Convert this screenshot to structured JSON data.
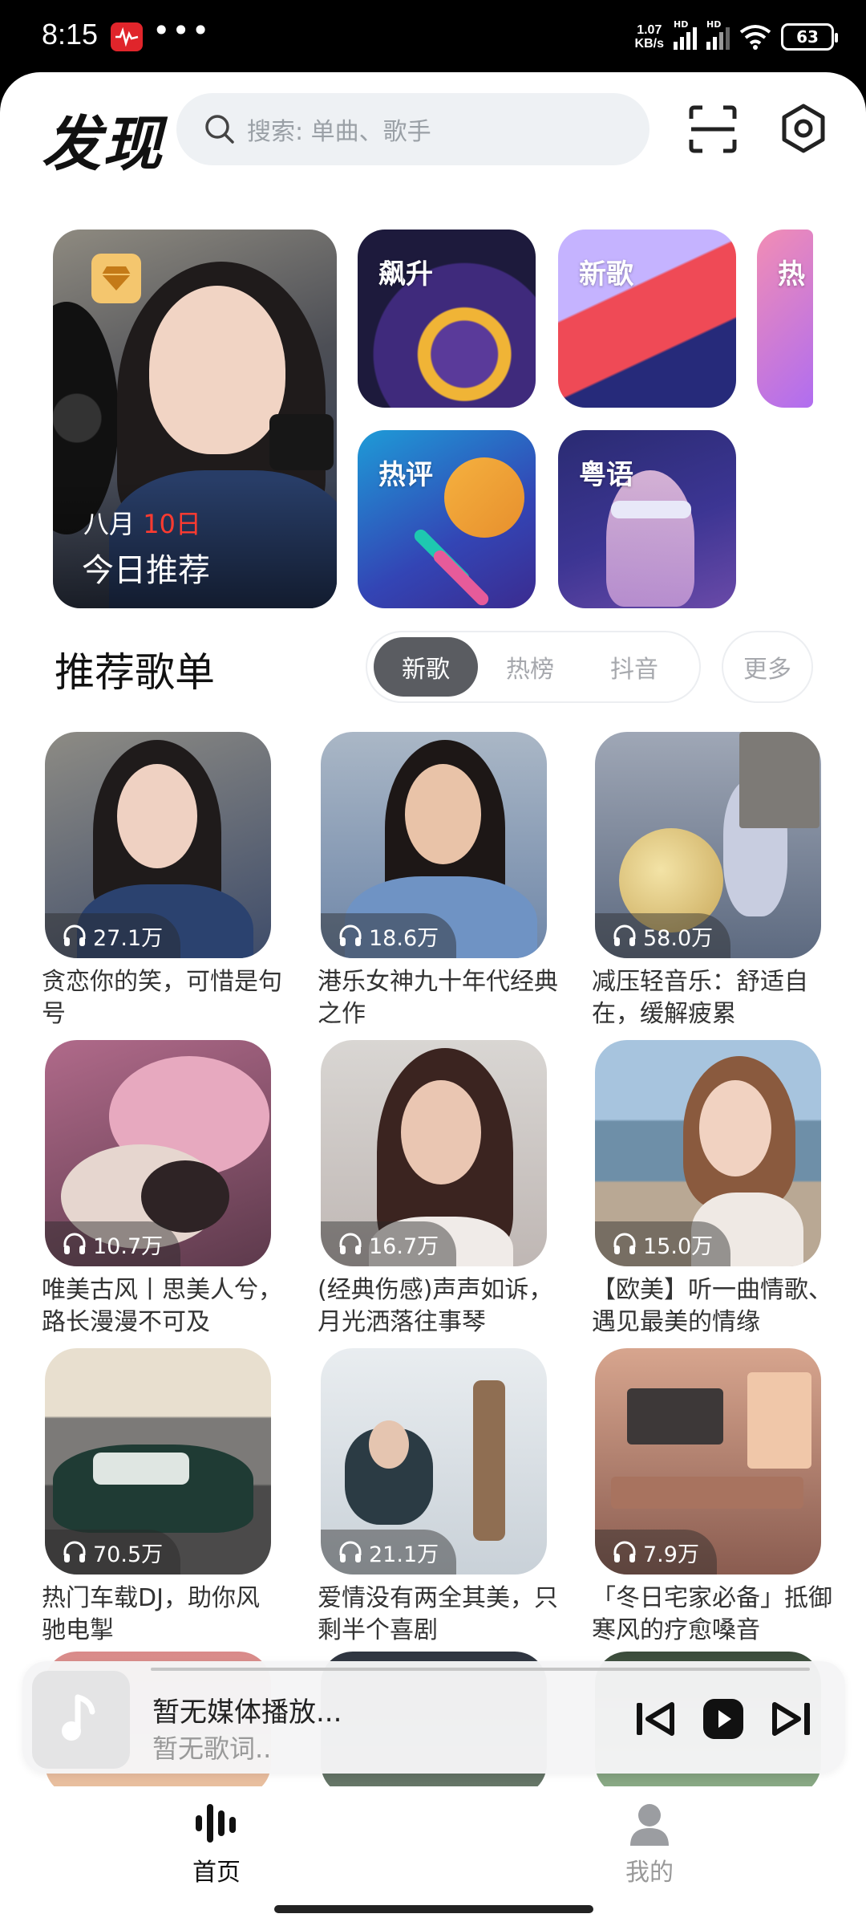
{
  "status_bar": {
    "time": "8:15",
    "dots": "•••",
    "net_speed_value": "1.07",
    "net_speed_unit": "KB/s",
    "signal_label_1": "HD",
    "signal_label_2": "HD",
    "battery": "63"
  },
  "header": {
    "title": "发现",
    "search_placeholder": "搜索: 单曲、歌手"
  },
  "today": {
    "month": "八月",
    "day": "10日",
    "title": "今日推荐"
  },
  "features": [
    {
      "label": "飙升"
    },
    {
      "label": "新歌"
    },
    {
      "label": "热"
    },
    {
      "label": "热评"
    },
    {
      "label": "粤语"
    }
  ],
  "section": {
    "title": "推荐歌单",
    "tabs": [
      "新歌",
      "热榜",
      "抖音"
    ],
    "more": "更多"
  },
  "playlists": [
    {
      "plays": "27.1万",
      "title": "贪恋你的笑，可惜是句号"
    },
    {
      "plays": "18.6万",
      "title": "港乐女神九十年代经典之作"
    },
    {
      "plays": "58.0万",
      "title": "减压轻音乐：舒适自在，缓解疲累"
    },
    {
      "plays": "10.7万",
      "title": "唯美古风丨思美人兮，路长漫漫不可及"
    },
    {
      "plays": "16.7万",
      "title": "(经典伤感)声声如诉，月光洒落往事琴"
    },
    {
      "plays": "15.0万",
      "title": "【欧美】听一曲情歌、遇见最美的情缘"
    },
    {
      "plays": "70.5万",
      "title": "热门车载DJ，助你风驰电掣"
    },
    {
      "plays": "21.1万",
      "title": "爱情没有两全其美，只剩半个喜剧"
    },
    {
      "plays": "7.9万",
      "title": "「冬日宅家必备」抵御寒风的疗愈嗓音"
    }
  ],
  "player": {
    "title": "暂无媒体播放...",
    "subtitle": "暂无歌词.."
  },
  "nav": {
    "home": "首页",
    "mine": "我的"
  },
  "colors": {
    "accent_red": "#ff3b30",
    "tab_active_bg": "#5a5c61",
    "search_bg": "#eef1f4"
  }
}
